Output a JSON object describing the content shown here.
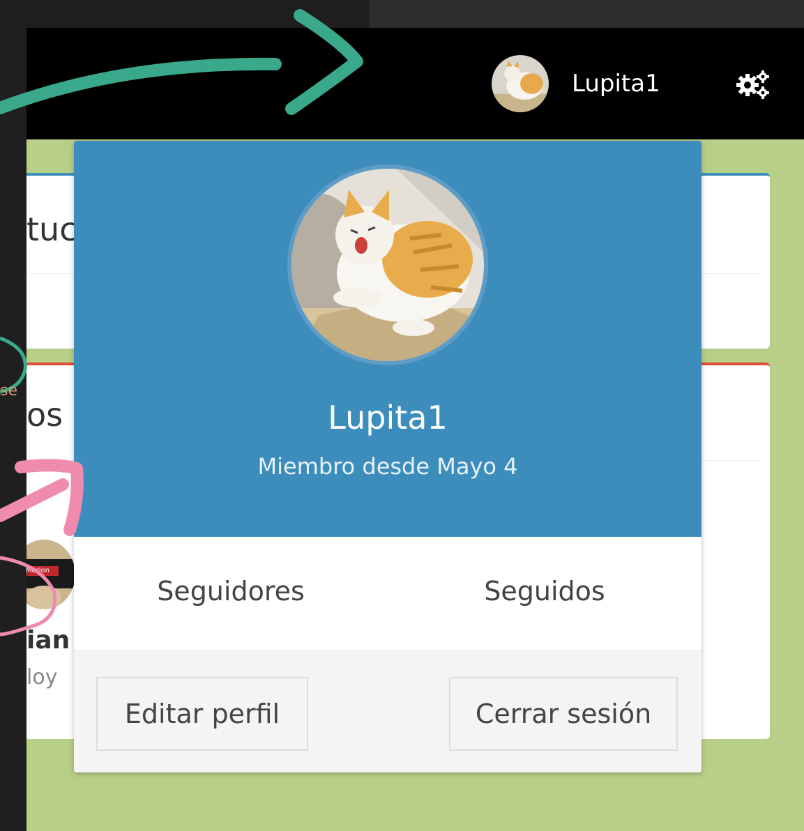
{
  "navbar": {
    "username": "Lupita1"
  },
  "background": {
    "card1_fragment": "tuc",
    "card2_fragment": "os",
    "side_fragment": "se",
    "member_name_fragment": "ian",
    "member_time_fragment": "loy",
    "avatar_badge": "Marlon"
  },
  "user_menu": {
    "name": "Lupita1",
    "member_since": "Miembro desde Mayo 4",
    "followers_label": "Seguidores",
    "following_label": "Seguidos",
    "edit_profile": "Editar perfil",
    "sign_out": "Cerrar sesión"
  },
  "colors": {
    "header_blue": "#3c8dbc",
    "page_green": "#b8cf88",
    "annotation_teal": "#3aa88a",
    "annotation_pink": "#f08bb0"
  },
  "icons": [
    "avatar",
    "gears-icon"
  ]
}
